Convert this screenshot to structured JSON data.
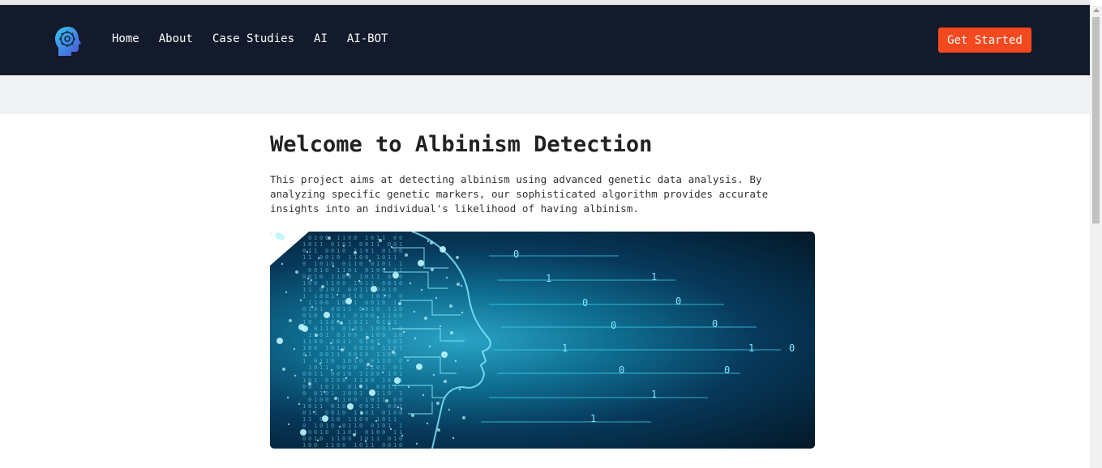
{
  "nav": {
    "links": [
      "Home",
      "About",
      "Case Studies",
      "AI",
      "AI-BOT"
    ],
    "cta_label": "Get Started"
  },
  "main": {
    "title": "Welcome to Albinism Detection",
    "description": "This project aims at detecting albinism using advanced genetic data analysis. By analyzing specific genetic markers, our sophisticated algorithm provides accurate insights into an individual's likelihood of having albinism."
  },
  "hero_image": {
    "digits": [
      "0",
      "1",
      "0",
      "0",
      "1",
      "1",
      "0",
      "0",
      "1",
      "0",
      "1",
      "1",
      "0",
      "0",
      "1",
      "0",
      "1",
      "1",
      "0",
      "1"
    ]
  },
  "colors": {
    "navbar": "#131a2c",
    "accent": "#f4491f",
    "band": "#f2f3f5"
  },
  "icons": {
    "logo": "brain-gear-icon"
  }
}
